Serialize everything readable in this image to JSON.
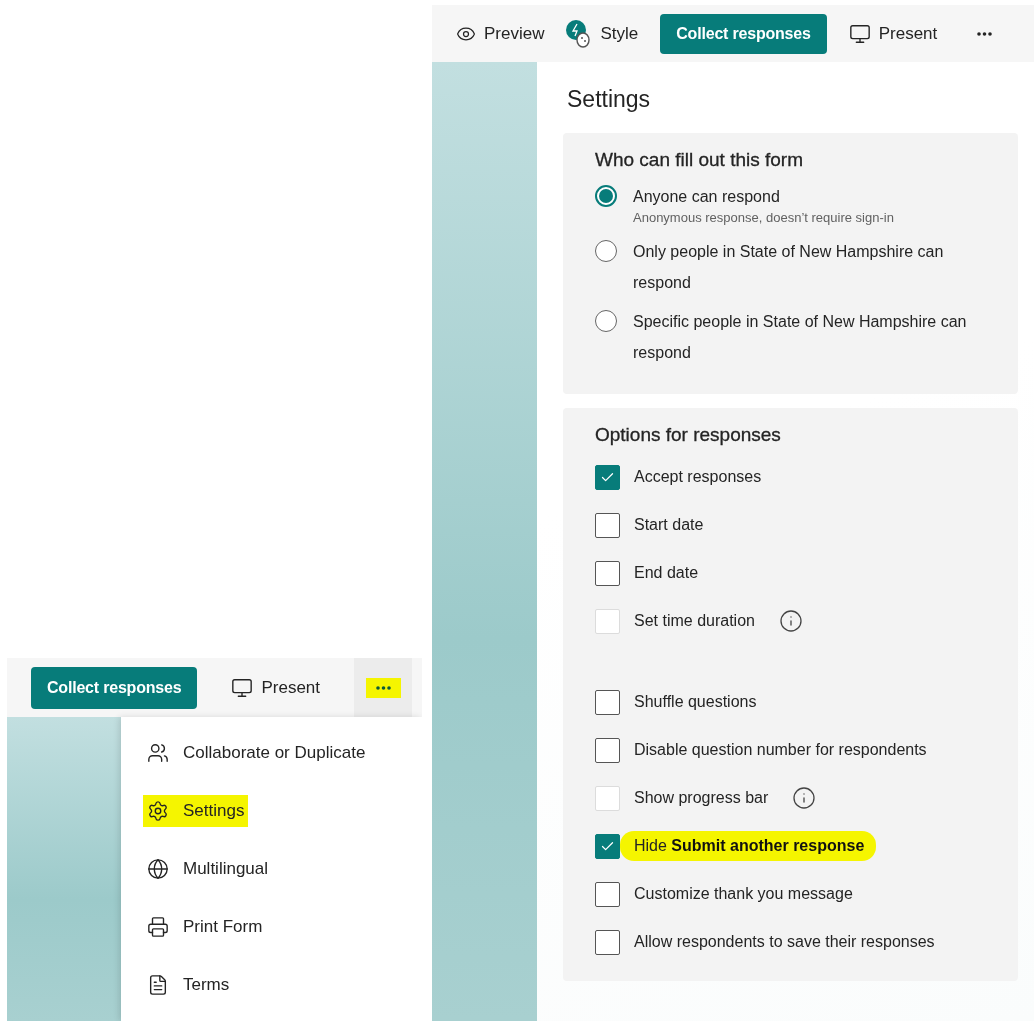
{
  "menu_view": {
    "toolbar": [
      {
        "kind": "primary",
        "label": "Collect responses"
      },
      {
        "kind": "present",
        "label": "Present"
      },
      {
        "kind": "more",
        "highlighted": true
      }
    ],
    "menu": [
      {
        "label": "Collaborate or Duplicate",
        "highlighted": false
      },
      {
        "label": "Settings",
        "highlighted": true
      },
      {
        "label": "Multilingual",
        "highlighted": false
      },
      {
        "label": "Print Form",
        "highlighted": false
      },
      {
        "label": "Terms",
        "highlighted": false
      }
    ]
  },
  "settings_view": {
    "toolbar": [
      {
        "kind": "preview",
        "label": "Preview"
      },
      {
        "kind": "style",
        "label": "Style"
      },
      {
        "kind": "primary",
        "label": "Collect responses"
      },
      {
        "kind": "present",
        "label": "Present"
      },
      {
        "kind": "more"
      }
    ],
    "title": "Settings",
    "who_can_fill": {
      "heading": "Who can fill out this form",
      "options": [
        {
          "label": "Anyone can respond",
          "hint": "Anonymous response, doesn’t require sign-in",
          "selected": true
        },
        {
          "label": "Only people in State of New Hampshire can respond",
          "selected": false
        },
        {
          "label": "Specific people in State of New Hampshire can respond",
          "selected": false
        }
      ]
    },
    "options_for_responses": {
      "heading": "Options for responses",
      "groups": [
        [
          {
            "kind": "plain",
            "label": "Accept responses",
            "checked": true,
            "disabled": false,
            "highlighted": false
          },
          {
            "kind": "plain",
            "label": "Start date",
            "checked": false,
            "disabled": false,
            "highlighted": false
          },
          {
            "kind": "plain",
            "label": "End date",
            "checked": false,
            "disabled": false,
            "highlighted": false
          },
          {
            "kind": "info",
            "label": "Set time duration",
            "checked": false,
            "disabled": true,
            "highlighted": false
          }
        ],
        [
          {
            "kind": "plain",
            "label": "Shuffle questions",
            "checked": false,
            "disabled": false,
            "highlighted": false
          },
          {
            "kind": "plain",
            "label": "Disable question number for respondents",
            "checked": false,
            "disabled": false,
            "highlighted": false
          },
          {
            "kind": "info",
            "label": "Show progress bar",
            "checked": false,
            "disabled": true,
            "highlighted": false
          },
          {
            "kind": "plain",
            "label": "Hide **Submit another response**",
            "checked": true,
            "disabled": false,
            "highlighted": true
          },
          {
            "kind": "plain",
            "label": "Customize thank you message",
            "checked": false,
            "disabled": false,
            "highlighted": false
          },
          {
            "kind": "plain",
            "label": "Allow respondents to save their responses",
            "checked": false,
            "disabled": false,
            "highlighted": false
          }
        ]
      ]
    }
  }
}
